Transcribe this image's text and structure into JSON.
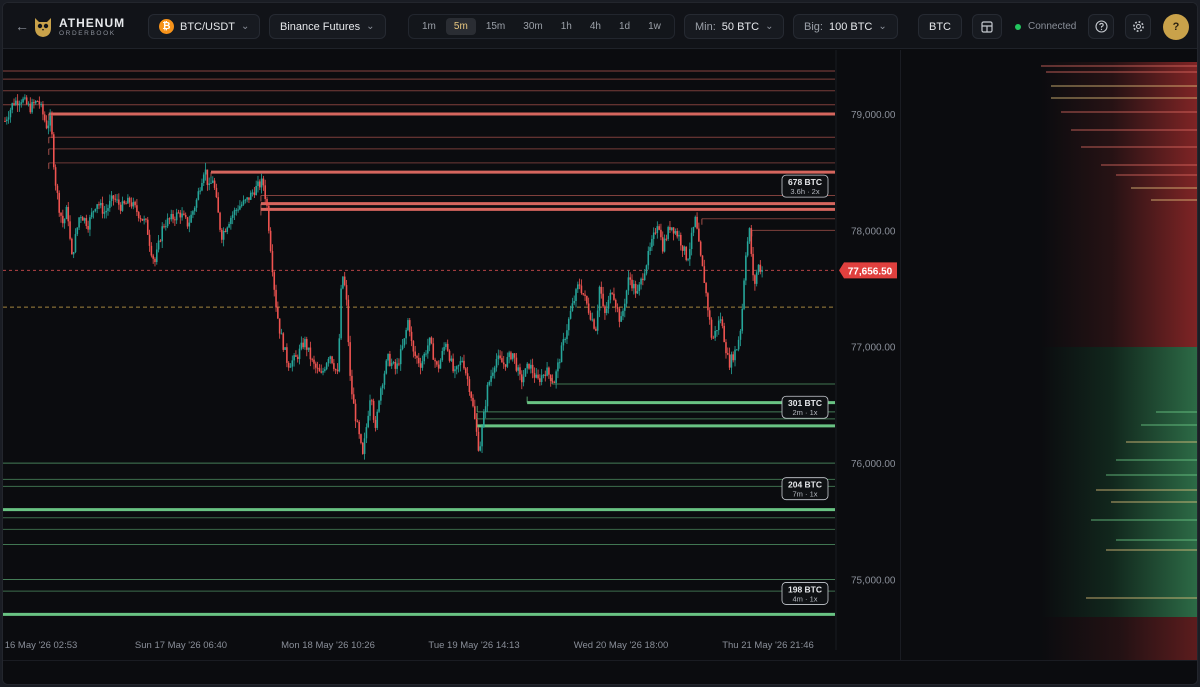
{
  "app": {
    "name": "ATHENUM",
    "subtitle": "ORDERBOOK"
  },
  "toolbar": {
    "symbol": "BTC/USDT",
    "coin_glyph": "₿",
    "exchange": "Binance Futures",
    "timeframes": [
      {
        "label": "1m",
        "active": false
      },
      {
        "label": "5m",
        "active": true
      },
      {
        "label": "15m",
        "active": false
      },
      {
        "label": "30m",
        "active": false
      },
      {
        "label": "1h",
        "active": false
      },
      {
        "label": "4h",
        "active": false
      },
      {
        "label": "1d",
        "active": false
      },
      {
        "label": "1w",
        "active": false
      }
    ],
    "min_label": "Min:",
    "min_value": "50 BTC",
    "big_label": "Big:",
    "big_value": "100 BTC",
    "unit_button": "BTC",
    "status": "Connected",
    "avatar": "?"
  },
  "colors": {
    "ask": "#e06c63",
    "bid": "#6fce8a",
    "candle_up": "#26a69a",
    "candle_down": "#ef5350",
    "accent": "#e8c780"
  },
  "chart_data": {
    "type": "candlestick",
    "y_ticks": [
      "79,000.00",
      "78,000.00",
      "77,000.00",
      "76,000.00",
      "75,000.00"
    ],
    "y_tick_values": [
      79000,
      78000,
      77000,
      76000,
      75000
    ],
    "ylim": [
      74600,
      79550
    ],
    "x_ticks": [
      "16 May '26 02:53",
      "Sun 17 May '26 06:40",
      "Mon 18 May '26 10:26",
      "Tue 19 May '26 14:13",
      "Wed 20 May '26 18:00",
      "Thu 21 May '26 21:46"
    ],
    "current_price": 77656.5,
    "current_price_label": "77,656.50",
    "dashed_level": 77340,
    "price_path": [
      [
        0,
        78940
      ],
      [
        0.01,
        79100
      ],
      [
        0.02,
        79130
      ],
      [
        0.03,
        79050
      ],
      [
        0.04,
        79120
      ],
      [
        0.05,
        78900
      ],
      [
        0.055,
        78950
      ],
      [
        0.06,
        78450
      ],
      [
        0.065,
        78200
      ],
      [
        0.07,
        78050
      ],
      [
        0.075,
        78200
      ],
      [
        0.08,
        77750
      ],
      [
        0.085,
        77950
      ],
      [
        0.09,
        78150
      ],
      [
        0.1,
        78050
      ],
      [
        0.11,
        78250
      ],
      [
        0.12,
        78150
      ],
      [
        0.13,
        78280
      ],
      [
        0.14,
        78200
      ],
      [
        0.15,
        78250
      ],
      [
        0.16,
        78150
      ],
      [
        0.17,
        78050
      ],
      [
        0.175,
        77850
      ],
      [
        0.18,
        77720
      ],
      [
        0.19,
        78050
      ],
      [
        0.2,
        78100
      ],
      [
        0.21,
        78150
      ],
      [
        0.22,
        78050
      ],
      [
        0.23,
        78250
      ],
      [
        0.24,
        78550
      ],
      [
        0.245,
        78350
      ],
      [
        0.25,
        78450
      ],
      [
        0.255,
        78200
      ],
      [
        0.26,
        77950
      ],
      [
        0.27,
        78100
      ],
      [
        0.28,
        78200
      ],
      [
        0.29,
        78250
      ],
      [
        0.3,
        78350
      ],
      [
        0.31,
        78420
      ],
      [
        0.315,
        78200
      ],
      [
        0.32,
        77800
      ],
      [
        0.325,
        77400
      ],
      [
        0.33,
        77150
      ],
      [
        0.34,
        76850
      ],
      [
        0.35,
        76900
      ],
      [
        0.36,
        77050
      ],
      [
        0.37,
        76850
      ],
      [
        0.38,
        76750
      ],
      [
        0.39,
        76950
      ],
      [
        0.4,
        76750
      ],
      [
        0.405,
        77650
      ],
      [
        0.41,
        77450
      ],
      [
        0.415,
        76700
      ],
      [
        0.42,
        76450
      ],
      [
        0.43,
        76050
      ],
      [
        0.44,
        76650
      ],
      [
        0.445,
        76250
      ],
      [
        0.45,
        76600
      ],
      [
        0.46,
        76900
      ],
      [
        0.47,
        76800
      ],
      [
        0.48,
        77050
      ],
      [
        0.485,
        77250
      ],
      [
        0.49,
        76950
      ],
      [
        0.5,
        76850
      ],
      [
        0.51,
        77050
      ],
      [
        0.52,
        76800
      ],
      [
        0.53,
        77050
      ],
      [
        0.54,
        76750
      ],
      [
        0.55,
        76900
      ],
      [
        0.56,
        76600
      ],
      [
        0.57,
        76100
      ],
      [
        0.58,
        76650
      ],
      [
        0.59,
        76900
      ],
      [
        0.6,
        76850
      ],
      [
        0.61,
        76950
      ],
      [
        0.62,
        76700
      ],
      [
        0.63,
        76850
      ],
      [
        0.64,
        76700
      ],
      [
        0.65,
        76800
      ],
      [
        0.66,
        76700
      ],
      [
        0.67,
        77000
      ],
      [
        0.68,
        77300
      ],
      [
        0.69,
        77550
      ],
      [
        0.7,
        77350
      ],
      [
        0.71,
        77150
      ],
      [
        0.715,
        77550
      ],
      [
        0.72,
        77250
      ],
      [
        0.73,
        77500
      ],
      [
        0.74,
        77200
      ],
      [
        0.75,
        77600
      ],
      [
        0.76,
        77450
      ],
      [
        0.77,
        77700
      ],
      [
        0.78,
        77950
      ],
      [
        0.785,
        78100
      ],
      [
        0.79,
        77850
      ],
      [
        0.8,
        78050
      ],
      [
        0.81,
        77950
      ],
      [
        0.82,
        77750
      ],
      [
        0.83,
        78100
      ],
      [
        0.835,
        77800
      ],
      [
        0.84,
        77600
      ],
      [
        0.85,
        77050
      ],
      [
        0.86,
        77250
      ],
      [
        0.87,
        76850
      ],
      [
        0.88,
        77000
      ],
      [
        0.885,
        77200
      ],
      [
        0.89,
        77800
      ],
      [
        0.895,
        78000
      ],
      [
        0.9,
        77500
      ],
      [
        0.905,
        77700
      ],
      [
        0.91,
        77656
      ]
    ],
    "ask_walls": [
      {
        "price": 79370,
        "size": 0.6,
        "from": 0
      },
      {
        "price": 79300,
        "size": 0.5,
        "from": 0
      },
      {
        "price": 79200,
        "size": 0.4,
        "from": 0
      },
      {
        "price": 79080,
        "size": 0.5,
        "from": 0
      },
      {
        "price": 79000,
        "size": 1.0,
        "from": 0.055,
        "thick": true
      },
      {
        "price": 78800,
        "size": 0.5,
        "from": 0.055
      },
      {
        "price": 78700,
        "size": 0.4,
        "from": 0.055
      },
      {
        "price": 78580,
        "size": 0.3,
        "from": 0.055
      },
      {
        "price": 78500,
        "size": 1.0,
        "from": 0.25,
        "thick": true
      },
      {
        "price": 78300,
        "size": 0.5,
        "from": 0.31
      },
      {
        "price": 78230,
        "size": 1.0,
        "from": 0.31,
        "thick": true
      },
      {
        "price": 78180,
        "size": 1.0,
        "from": 0.31,
        "thick": true
      },
      {
        "price": 78100,
        "size": 0.4,
        "from": 0.84
      },
      {
        "price": 78000,
        "size": 0.5,
        "from": 0.9
      }
    ],
    "bid_walls": [
      {
        "price": 76680,
        "size": 0.5,
        "from": 0.66
      },
      {
        "price": 76520,
        "size": 1.0,
        "from": 0.63,
        "thick": true
      },
      {
        "price": 76440,
        "size": 0.6,
        "from": 0.57
      },
      {
        "price": 76380,
        "size": 0.5,
        "from": 0.57
      },
      {
        "price": 76320,
        "size": 1.0,
        "from": 0.57,
        "thick": true
      },
      {
        "price": 76000,
        "size": 0.6,
        "from": 0
      },
      {
        "price": 75860,
        "size": 0.4,
        "from": 0
      },
      {
        "price": 75800,
        "size": 0.4,
        "from": 0
      },
      {
        "price": 75600,
        "size": 1.0,
        "from": 0,
        "thick": true
      },
      {
        "price": 75530,
        "size": 0.4,
        "from": 0
      },
      {
        "price": 75430,
        "size": 0.3,
        "from": 0
      },
      {
        "price": 75300,
        "size": 0.5,
        "from": 0
      },
      {
        "price": 75000,
        "size": 0.6,
        "from": 0
      },
      {
        "price": 74900,
        "size": 0.4,
        "from": 0
      },
      {
        "price": 74700,
        "size": 1.0,
        "from": 0,
        "thick": true
      }
    ],
    "wall_labels": [
      {
        "price": 78380,
        "size": "678 BTC",
        "meta": "3.6h · 2x"
      },
      {
        "price": 76480,
        "size": "301 BTC",
        "meta": "2m · 1x"
      },
      {
        "price": 75780,
        "size": "204 BTC",
        "meta": "7m · 1x"
      },
      {
        "price": 74880,
        "size": "198 BTC",
        "meta": "4m · 1x"
      }
    ]
  }
}
